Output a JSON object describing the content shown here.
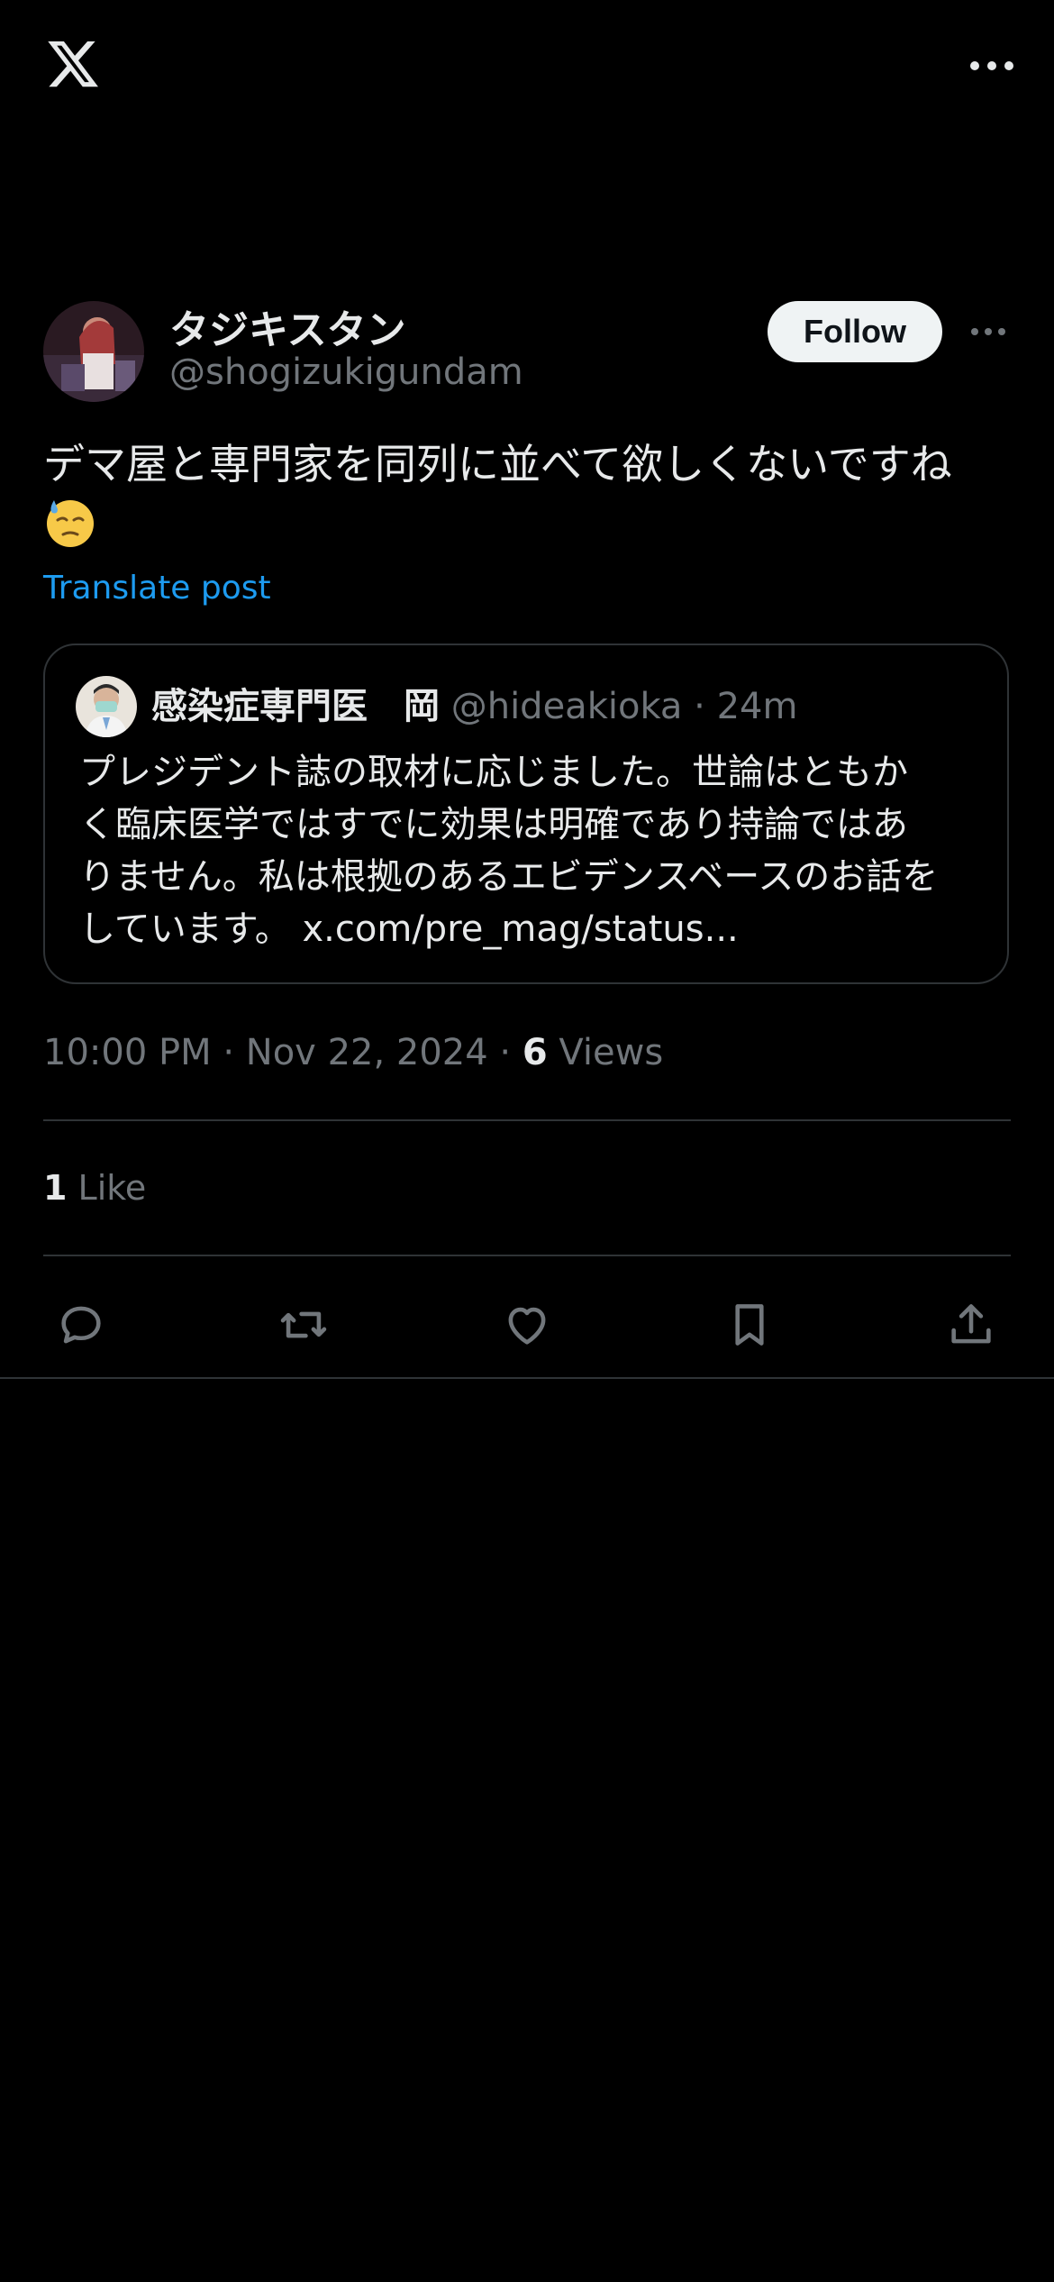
{
  "topbar": {
    "logo_icon": "x-logo-icon",
    "more_icon": "more-horizontal-icon"
  },
  "author": {
    "name": "タジキスタン",
    "handle": "@shogizukigundam",
    "follow_label": "Follow"
  },
  "post": {
    "text_line1": "デマ屋と専門家を同列に並べて欲しくないですね",
    "emoji_icon": "downcast-sweat-emoji-icon",
    "translate_label": "Translate post"
  },
  "quote": {
    "name": "感染症専門医　岡",
    "handle": "@hideakioka",
    "separator": "·",
    "time": "24m",
    "lines": [
      "プレジデント誌の取材に応じました。世論はともか",
      "く臨床医学ではすでに効果は明確であり持論ではあ",
      "りません。私は根拠のあるエビデンスベースのお話を",
      "しています。 x.com/pre_mag/status..."
    ]
  },
  "meta": {
    "time": "10:00 PM",
    "separator": "·",
    "date": "Nov 22, 2024",
    "views_count": "6",
    "views_label": "Views"
  },
  "likes": {
    "count": "1",
    "label": "Like"
  },
  "actions": {
    "reply_icon": "reply-icon",
    "repost_icon": "repost-icon",
    "like_icon": "heart-icon",
    "bookmark_icon": "bookmark-icon",
    "share_icon": "share-icon"
  },
  "colors": {
    "background": "#000000",
    "text_primary": "#e7e9ea",
    "text_secondary": "#71767b",
    "link": "#1d9bf0",
    "border": "#2f3336",
    "follow_bg": "#eff3f4"
  }
}
